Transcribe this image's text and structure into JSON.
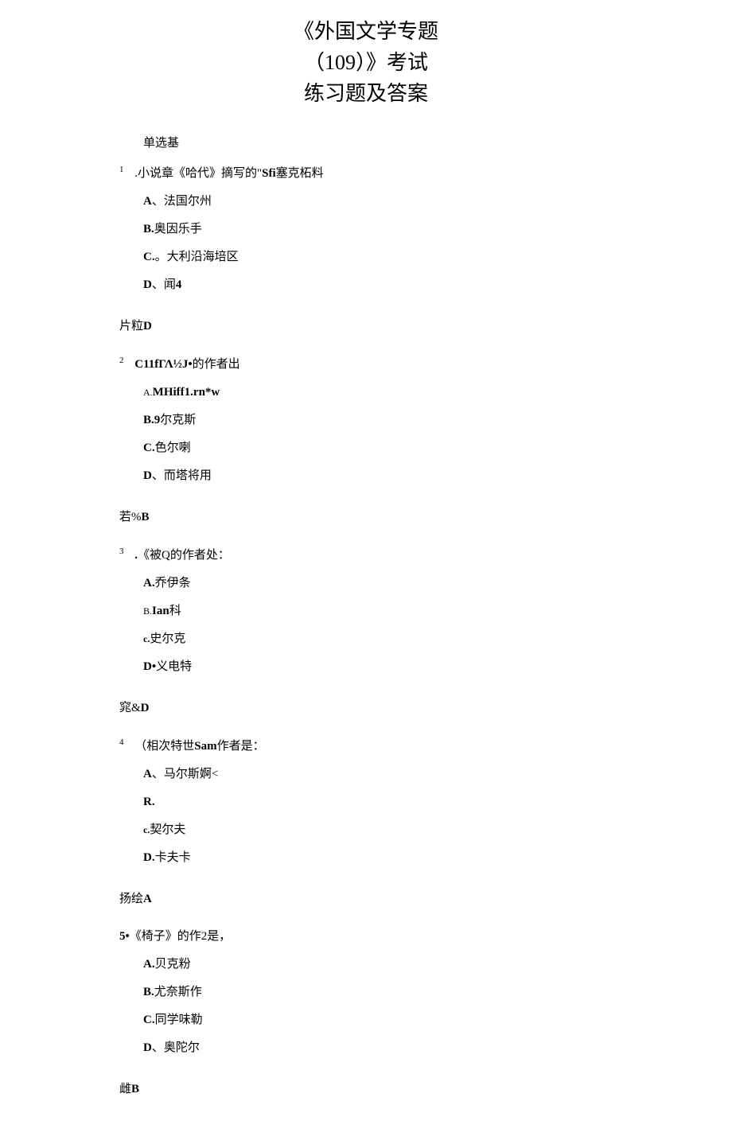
{
  "title_line1": "《外国文学专题",
  "title_line2": "（109）》考试",
  "title_line3": "练习题及答案",
  "section_label": "单选基",
  "questions": [
    {
      "number": "1",
      "prefix": ".小说章《哈代》摘写的\"",
      "bold_part": "Sfi",
      "suffix": "塞克柘料",
      "options": [
        {
          "label": "A",
          "sep": "、",
          "text": "法国尔州"
        },
        {
          "label": "B.",
          "sep": "",
          "text": "奥因乐手"
        },
        {
          "label": "C.",
          "sep": "。",
          "text": "大利沿海培区"
        },
        {
          "label": "D",
          "sep": "、",
          "text": "闻",
          "bold_suffix": "4"
        }
      ],
      "answer_prefix": "片粒",
      "answer_letter": "D"
    },
    {
      "number": "2",
      "prefix": "",
      "bold_part": "C11fΓΛ½J•",
      "suffix": "的作者出",
      "options": [
        {
          "label": "A.",
          "sep": "",
          "bold_text": "MHiff1.rn*w"
        },
        {
          "label": "B.9",
          "sep": "",
          "text": "尔克斯"
        },
        {
          "label": "C.",
          "sep": "",
          "text": "色尔喇"
        },
        {
          "label": "D",
          "sep": "、",
          "text": "而塔将用"
        }
      ],
      "answer_prefix": "若%",
      "answer_letter": "B"
    },
    {
      "number": "3",
      "prefix": "",
      "bold_part": ".",
      "suffix": "《被Q的作者处：",
      "options": [
        {
          "label": "A.",
          "sep": "",
          "text": "乔伊条"
        },
        {
          "label_small": "B.",
          "bold_text": "Ian",
          "text": "科"
        },
        {
          "label_small": "c.",
          "text": "史尔克"
        },
        {
          "label": "D•",
          "sep": "",
          "text": "义电特"
        }
      ],
      "answer_prefix": "窕&",
      "answer_letter": "D"
    },
    {
      "number": "4",
      "prefix": "（相次特世",
      "bold_part": "Sam",
      "suffix": "作者是：",
      "options": [
        {
          "label": "A",
          "sep": "、",
          "text": "马尔斯婀<"
        },
        {
          "label": "R.",
          "sep": "",
          "text": ""
        },
        {
          "label_small": "c.",
          "text": "契尔夫"
        },
        {
          "label": "D.",
          "sep": "",
          "text": "卡夫卡"
        }
      ],
      "answer_prefix": "扬绘",
      "answer_letter": "A"
    },
    {
      "number_inline": "5•",
      "prefix": "《椅子》的作2是，",
      "options": [
        {
          "label": "A.",
          "sep": "",
          "text": "贝克粉"
        },
        {
          "label": "B.",
          "sep": "",
          "text": "尤奈斯作"
        },
        {
          "label": "C.",
          "sep": "",
          "text": "同学味勒"
        },
        {
          "label": "D",
          "sep": "、",
          "text": "奥陀尔"
        }
      ],
      "answer_prefix": "雌",
      "answer_letter": "B"
    }
  ]
}
